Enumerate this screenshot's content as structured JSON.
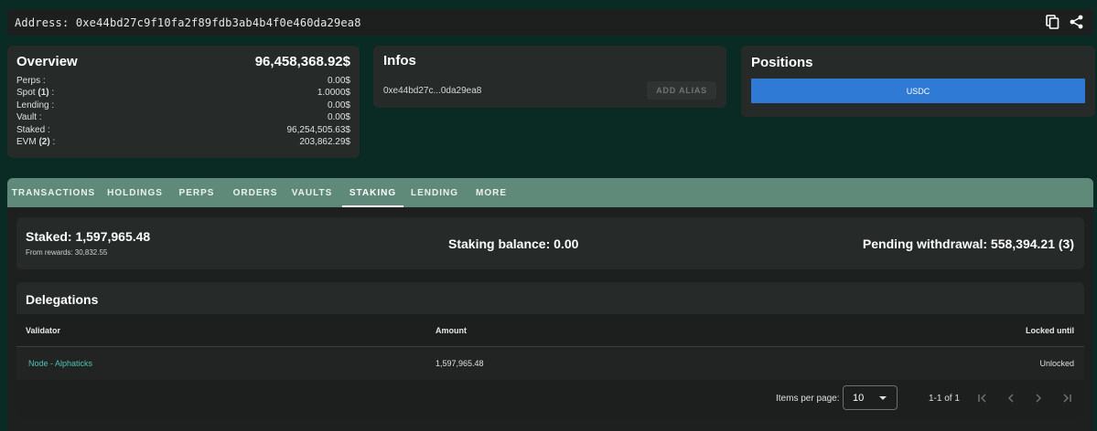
{
  "address": {
    "label": "Address: 0xe44bd27c9f10fa2f89fdb3ab4b4f0e460da29ea8"
  },
  "overview": {
    "title": "Overview",
    "total": "96,458,368.92$",
    "rows": [
      {
        "label": "Perps :",
        "count": "",
        "value": "0.00$"
      },
      {
        "label": "Spot",
        "count": "(1)",
        "suffix": ":",
        "value": "1.0000$"
      },
      {
        "label": "Lending :",
        "count": "",
        "value": "0.00$"
      },
      {
        "label": "Vault :",
        "count": "",
        "value": "0.00$"
      },
      {
        "label": "Staked :",
        "count": "",
        "value": "96,254,505.63$"
      },
      {
        "label": "EVM",
        "count": "(2)",
        "suffix": ":",
        "value": "203,862.29$"
      }
    ]
  },
  "infos": {
    "title": "Infos",
    "short_address": "0xe44bd27c...0da29ea8",
    "alias_button": "ADD ALIAS"
  },
  "positions": {
    "title": "Positions",
    "bar_label": "USDC",
    "bar_color": "#2f7ad4"
  },
  "tabs": [
    "TRANSACTIONS",
    "HOLDINGS",
    "PERPS",
    "ORDERS",
    "VAULTS",
    "STAKING",
    "LENDING",
    "MORE"
  ],
  "active_tab": "STAKING",
  "staking": {
    "staked": "Staked: 1,597,965.48",
    "from_rewards": "From rewards: 30,832.55",
    "balance": "Staking balance: 0.00",
    "pending": "Pending withdrawal: 558,394.21 (3)"
  },
  "delegations": {
    "title": "Delegations",
    "columns": {
      "validator": "Validator",
      "amount": "Amount",
      "locked": "Locked until"
    },
    "rows": [
      {
        "validator": "Node - Alphaticks",
        "amount": "1,597,965.48",
        "locked": "Unlocked"
      }
    ]
  },
  "paginator": {
    "items_per_page_label": "Items per page:",
    "items_per_page": "10",
    "range": "1-1 of 1"
  },
  "colors": {
    "background": "#0a2a24",
    "tab_bar": "#5f8a7a",
    "link": "#4fc3b4",
    "accent_blue": "#2f7ad4"
  }
}
